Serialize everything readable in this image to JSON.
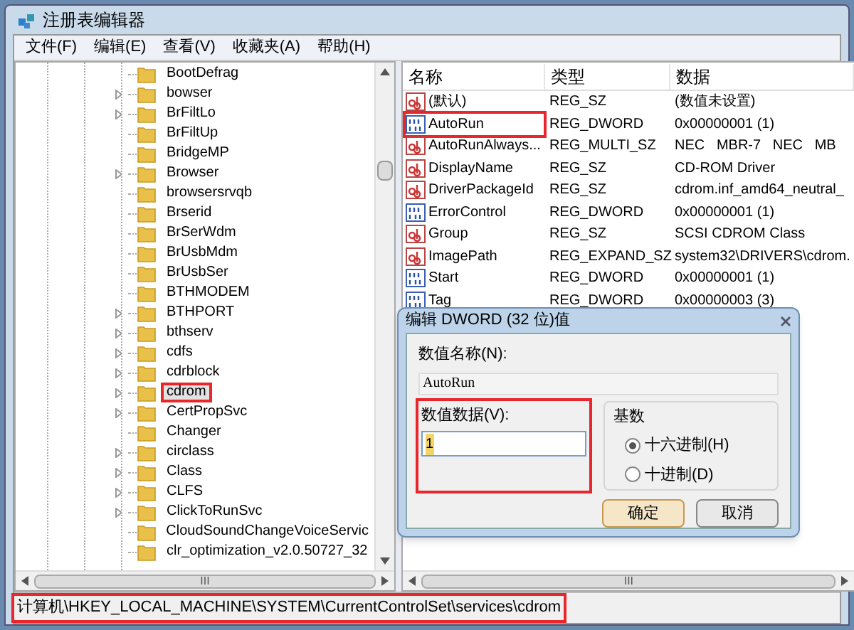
{
  "window": {
    "title": "注册表编辑器"
  },
  "menu": [
    "文件(F)",
    "编辑(E)",
    "查看(V)",
    "收藏夹(A)",
    "帮助(H)"
  ],
  "tree": {
    "items": [
      {
        "label": "BootDefrag",
        "expandable": false,
        "selected": false,
        "highlighted": false
      },
      {
        "label": "bowser",
        "expandable": true,
        "selected": false,
        "highlighted": false
      },
      {
        "label": "BrFiltLo",
        "expandable": true,
        "selected": false,
        "highlighted": false
      },
      {
        "label": "BrFiltUp",
        "expandable": false,
        "selected": false,
        "highlighted": false
      },
      {
        "label": "BridgeMP",
        "expandable": false,
        "selected": false,
        "highlighted": false
      },
      {
        "label": "Browser",
        "expandable": true,
        "selected": false,
        "highlighted": false
      },
      {
        "label": "browsersrvqb",
        "expandable": false,
        "selected": false,
        "highlighted": false
      },
      {
        "label": "Brserid",
        "expandable": false,
        "selected": false,
        "highlighted": false
      },
      {
        "label": "BrSerWdm",
        "expandable": false,
        "selected": false,
        "highlighted": false
      },
      {
        "label": "BrUsbMdm",
        "expandable": false,
        "selected": false,
        "highlighted": false
      },
      {
        "label": "BrUsbSer",
        "expandable": false,
        "selected": false,
        "highlighted": false
      },
      {
        "label": "BTHMODEM",
        "expandable": false,
        "selected": false,
        "highlighted": false
      },
      {
        "label": "BTHPORT",
        "expandable": true,
        "selected": false,
        "highlighted": false
      },
      {
        "label": "bthserv",
        "expandable": true,
        "selected": false,
        "highlighted": false
      },
      {
        "label": "cdfs",
        "expandable": true,
        "selected": false,
        "highlighted": false
      },
      {
        "label": "cdrblock",
        "expandable": true,
        "selected": false,
        "highlighted": false
      },
      {
        "label": "cdrom",
        "expandable": true,
        "selected": true,
        "highlighted": true
      },
      {
        "label": "CertPropSvc",
        "expandable": true,
        "selected": false,
        "highlighted": false
      },
      {
        "label": "Changer",
        "expandable": false,
        "selected": false,
        "highlighted": false
      },
      {
        "label": "circlass",
        "expandable": true,
        "selected": false,
        "highlighted": false
      },
      {
        "label": "Class",
        "expandable": true,
        "selected": false,
        "highlighted": false
      },
      {
        "label": "CLFS",
        "expandable": true,
        "selected": false,
        "highlighted": false
      },
      {
        "label": "ClickToRunSvc",
        "expandable": true,
        "selected": false,
        "highlighted": false
      },
      {
        "label": "CloudSoundChangeVoiceServic",
        "expandable": false,
        "selected": false,
        "highlighted": false
      },
      {
        "label": "clr_optimization_v2.0.50727_32",
        "expandable": false,
        "selected": false,
        "highlighted": false
      }
    ]
  },
  "values": {
    "columns": [
      "名称",
      "类型",
      "数据"
    ],
    "rows": [
      {
        "kind": "string",
        "name": "(默认)",
        "type": "REG_SZ",
        "data": "(数值未设置)",
        "highlighted": false
      },
      {
        "kind": "binary",
        "name": "AutoRun",
        "type": "REG_DWORD",
        "data": "0x00000001 (1)",
        "highlighted": true
      },
      {
        "kind": "string",
        "name": "AutoRunAlways...",
        "type": "REG_MULTI_SZ",
        "data": "NEC   MBR-7   NEC   MB",
        "highlighted": false
      },
      {
        "kind": "string",
        "name": "DisplayName",
        "type": "REG_SZ",
        "data": "CD-ROM Driver",
        "highlighted": false
      },
      {
        "kind": "string",
        "name": "DriverPackageId",
        "type": "REG_SZ",
        "data": "cdrom.inf_amd64_neutral_",
        "highlighted": false
      },
      {
        "kind": "binary",
        "name": "ErrorControl",
        "type": "REG_DWORD",
        "data": "0x00000001 (1)",
        "highlighted": false
      },
      {
        "kind": "string",
        "name": "Group",
        "type": "REG_SZ",
        "data": "SCSI CDROM Class",
        "highlighted": false
      },
      {
        "kind": "string",
        "name": "ImagePath",
        "type": "REG_EXPAND_SZ",
        "data": "system32\\DRIVERS\\cdrom.",
        "highlighted": false
      },
      {
        "kind": "binary",
        "name": "Start",
        "type": "REG_DWORD",
        "data": "0x00000001 (1)",
        "highlighted": false
      },
      {
        "kind": "binary",
        "name": "Tag",
        "type": "REG_DWORD",
        "data": "0x00000003 (3)",
        "highlighted": false
      }
    ]
  },
  "dialog": {
    "title": "编辑 DWORD (32 位)值",
    "name_label": "数值名称(N):",
    "name_value": "AutoRun",
    "data_label": "数值数据(V):",
    "data_value": "1",
    "data_highlighted": true,
    "base_label": "基数",
    "radios": [
      {
        "label": "十六进制(H)",
        "selected": true
      },
      {
        "label": "十进制(D)",
        "selected": false
      }
    ],
    "buttons": [
      "确定",
      "取消"
    ]
  },
  "scrollbar_grips": [
    "III",
    "III"
  ],
  "status_bar": {
    "path": "计算机\\HKEY_LOCAL_MACHINE\\SYSTEM\\CurrentControlSet\\services\\cdrom",
    "highlighted": true
  }
}
